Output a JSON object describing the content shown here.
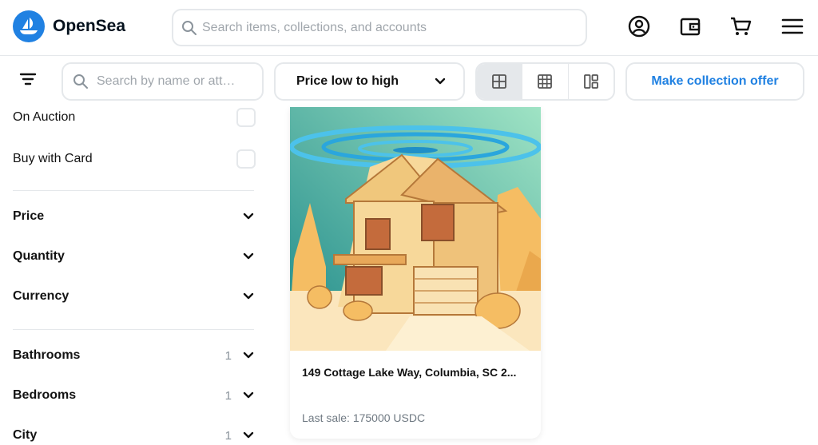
{
  "brand": {
    "name": "OpenSea",
    "color": "#2081e2"
  },
  "header": {
    "search_placeholder": "Search items, collections, and accounts",
    "icons": [
      "account-icon",
      "wallet-icon",
      "cart-icon",
      "menu-icon"
    ]
  },
  "toolbar": {
    "search_placeholder": "Search by name or att…",
    "sort_label": "Price low to high",
    "view_modes": [
      "grid-large-icon",
      "grid-small-icon",
      "masonry-icon"
    ],
    "offer_label": "Make collection offer"
  },
  "sidebar": {
    "status": [
      {
        "label": "On Auction",
        "checked": false
      },
      {
        "label": "Buy with Card",
        "checked": false
      }
    ],
    "filters": [
      {
        "label": "Price"
      },
      {
        "label": "Quantity"
      },
      {
        "label": "Currency"
      }
    ],
    "traits": [
      {
        "label": "Bathrooms",
        "count": "1"
      },
      {
        "label": "Bedrooms",
        "count": "1"
      },
      {
        "label": "City",
        "count": "1"
      }
    ]
  },
  "item": {
    "title": "149 Cottage Lake Way, Columbia, SC 2...",
    "last_sale": "Last sale: 175000 USDC"
  }
}
